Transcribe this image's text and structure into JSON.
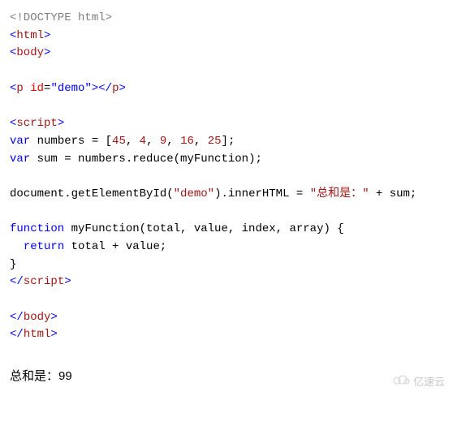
{
  "code": {
    "l1": "<!DOCTYPE html>",
    "l2_open": "<",
    "l2_tag": "html",
    "l2_close": ">",
    "l3_open": "<",
    "l3_tag": "body",
    "l3_close": ">",
    "l5_open": "<",
    "l5_tag": "p",
    "l5_sp": " ",
    "l5_attr": "id",
    "l5_eq": "=",
    "l5_val": "\"demo\"",
    "l5_close": ">",
    "l5_end_open": "</",
    "l5_end_tag": "p",
    "l5_end_close": ">",
    "l7_open": "<",
    "l7_tag": "script",
    "l7_close": ">",
    "l8_kw": "var",
    "l8_rest_a": " numbers = [",
    "l8_n1": "45",
    "l8_c1": ", ",
    "l8_n2": "4",
    "l8_c2": ", ",
    "l8_n3": "9",
    "l8_c3": ", ",
    "l8_n4": "16",
    "l8_c4": ", ",
    "l8_n5": "25",
    "l8_rest_b": "];",
    "l9_kw": "var",
    "l9_rest": " sum = numbers.reduce(myFunction);",
    "l11_a": "document.getElementById(",
    "l11_s1": "\"demo\"",
    "l11_b": ").innerHTML = ",
    "l11_s2": "\"总和是：\"",
    "l11_c": " + sum;",
    "l13_kw": "function",
    "l13_rest": " myFunction(total, value, index, array) {",
    "l14_indent": "  ",
    "l14_kw": "return",
    "l14_rest": " total + value;",
    "l15": "}",
    "l16_open": "</",
    "l16_tag": "script",
    "l16_close": ">",
    "l18_open": "</",
    "l18_tag": "body",
    "l18_close": ">",
    "l19_open": "</",
    "l19_tag": "html",
    "l19_close": ">"
  },
  "output": "总和是：99",
  "watermark": "亿速云"
}
